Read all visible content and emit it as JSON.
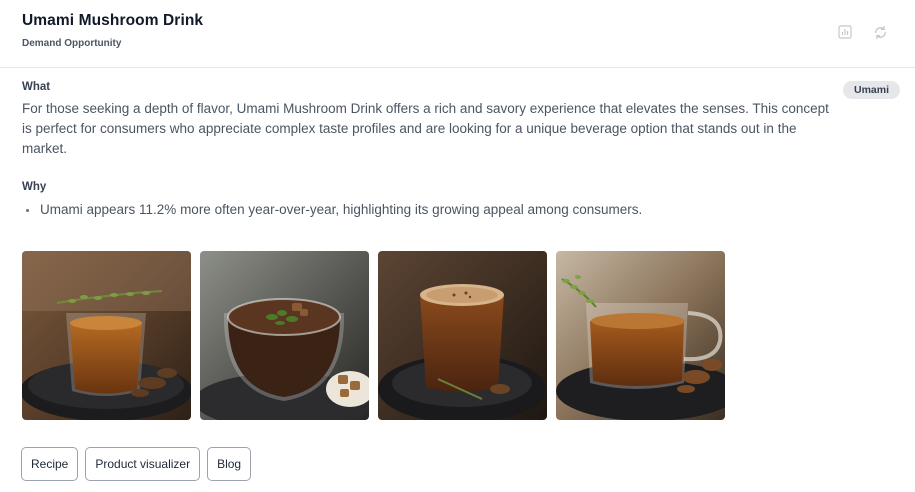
{
  "header": {
    "title": "Umami Mushroom Drink",
    "subtitle": "Demand Opportunity"
  },
  "icons": {
    "chart": "chart-icon",
    "refresh": "refresh-icon"
  },
  "what": {
    "label": "What",
    "text": "For those seeking a depth of flavor, Umami Mushroom Drink offers a rich and savory experience that elevates the senses. This concept is perfect for consumers who appreciate complex taste profiles and are looking for a unique beverage option that stands out in the market."
  },
  "badge": "Umami",
  "why": {
    "label": "Why",
    "bullets": [
      "Umami appears 11.2% more often year-over-year, highlighting its growing appeal among consumers."
    ]
  },
  "actions": {
    "recipe": "Recipe",
    "visualizer": "Product visualizer",
    "blog": "Blog"
  },
  "colors": {
    "accent_text": "#111827",
    "body_text": "#4b5563",
    "badge_bg": "#e5e7eb",
    "border": "#9ca3af"
  }
}
